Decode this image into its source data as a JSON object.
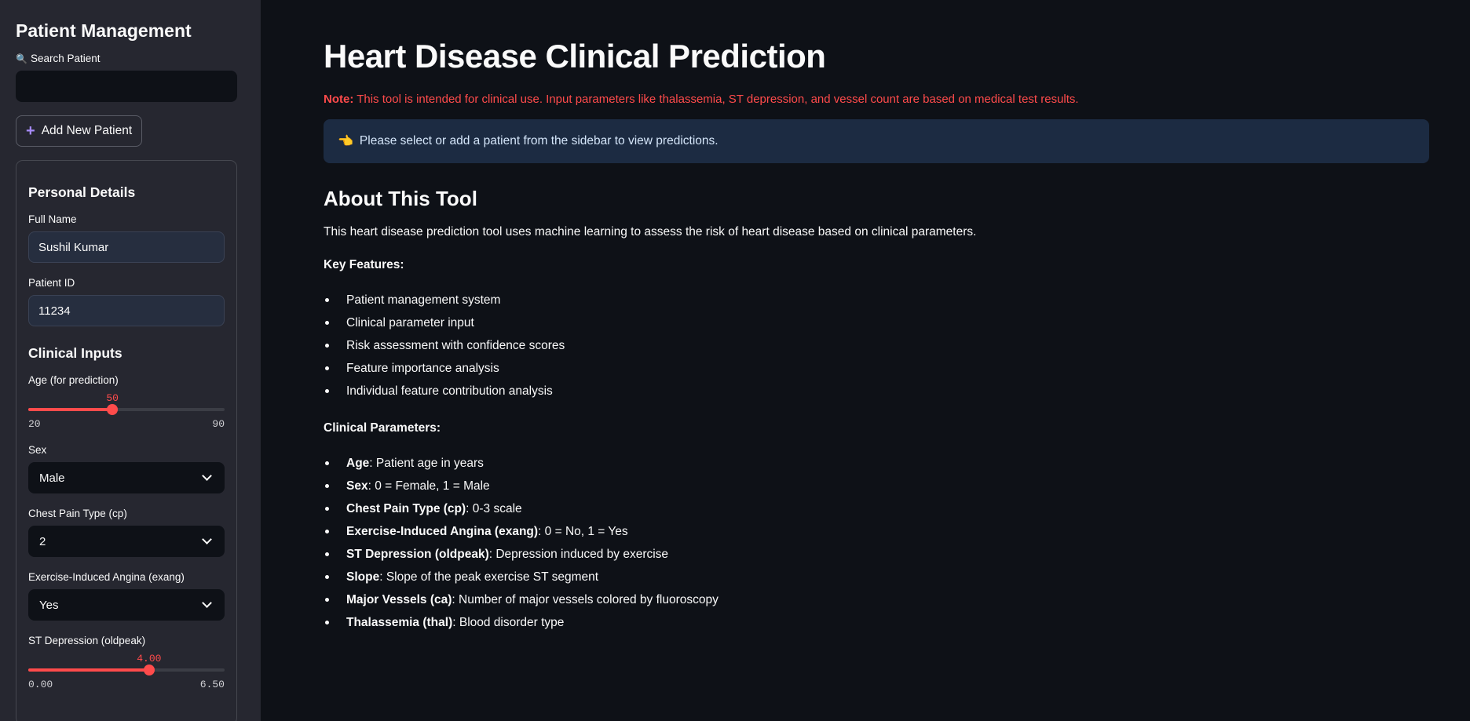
{
  "sidebar": {
    "title": "Patient Management",
    "search": {
      "icon": "magnifier-icon",
      "label": "Search Patient",
      "value": ""
    },
    "add_button": "Add New Patient",
    "personal": {
      "heading": "Personal Details",
      "full_name_label": "Full Name",
      "full_name_value": "Sushil Kumar",
      "patient_id_label": "Patient ID",
      "patient_id_value": "11234"
    },
    "clinical": {
      "heading": "Clinical Inputs",
      "age": {
        "label": "Age (for prediction)",
        "value": "50",
        "min": "20",
        "max": "90",
        "fraction": 0.4286
      },
      "sex": {
        "label": "Sex",
        "value": "Male"
      },
      "cp": {
        "label": "Chest Pain Type (cp)",
        "value": "2"
      },
      "exang": {
        "label": "Exercise-Induced Angina (exang)",
        "value": "Yes"
      },
      "oldpeak": {
        "label": "ST Depression (oldpeak)",
        "value": "4.00",
        "min": "0.00",
        "max": "6.50",
        "fraction": 0.6154
      }
    }
  },
  "main": {
    "title": "Heart Disease Clinical Prediction",
    "note_label": "Note:",
    "note_text": " This tool is intended for clinical use. Input parameters like thalassemia, ST depression, and vessel count are based on medical test results.",
    "info_icon": "pointing-hand-icon",
    "info_text": "Please select or add a patient from the sidebar to view predictions.",
    "about_heading": "About This Tool",
    "about_text": "This heart disease prediction tool uses machine learning to assess the risk of heart disease based on clinical parameters.",
    "key_features_heading": "Key Features:",
    "key_features": [
      "Patient management system",
      "Clinical parameter input",
      "Risk assessment with confidence scores",
      "Feature importance analysis",
      "Individual feature contribution analysis"
    ],
    "clinical_params_heading": "Clinical Parameters:",
    "clinical_params": [
      {
        "term": "Age",
        "desc": ": Patient age in years"
      },
      {
        "term": "Sex",
        "desc": ": 0 = Female, 1 = Male"
      },
      {
        "term": "Chest Pain Type (cp)",
        "desc": ": 0-3 scale"
      },
      {
        "term": "Exercise-Induced Angina (exang)",
        "desc": ": 0 = No, 1 = Yes"
      },
      {
        "term": "ST Depression (oldpeak)",
        "desc": ": Depression induced by exercise"
      },
      {
        "term": "Slope",
        "desc": ": Slope of the peak exercise ST segment"
      },
      {
        "term": "Major Vessels (ca)",
        "desc": ": Number of major vessels colored by fluoroscopy"
      },
      {
        "term": "Thalassemia (thal)",
        "desc": ": Blood disorder type"
      }
    ]
  },
  "colors": {
    "accent": "#ff4b4b",
    "info_bg": "#1c2b42",
    "sidebar_bg": "#262730",
    "page_bg": "#0e1117"
  }
}
